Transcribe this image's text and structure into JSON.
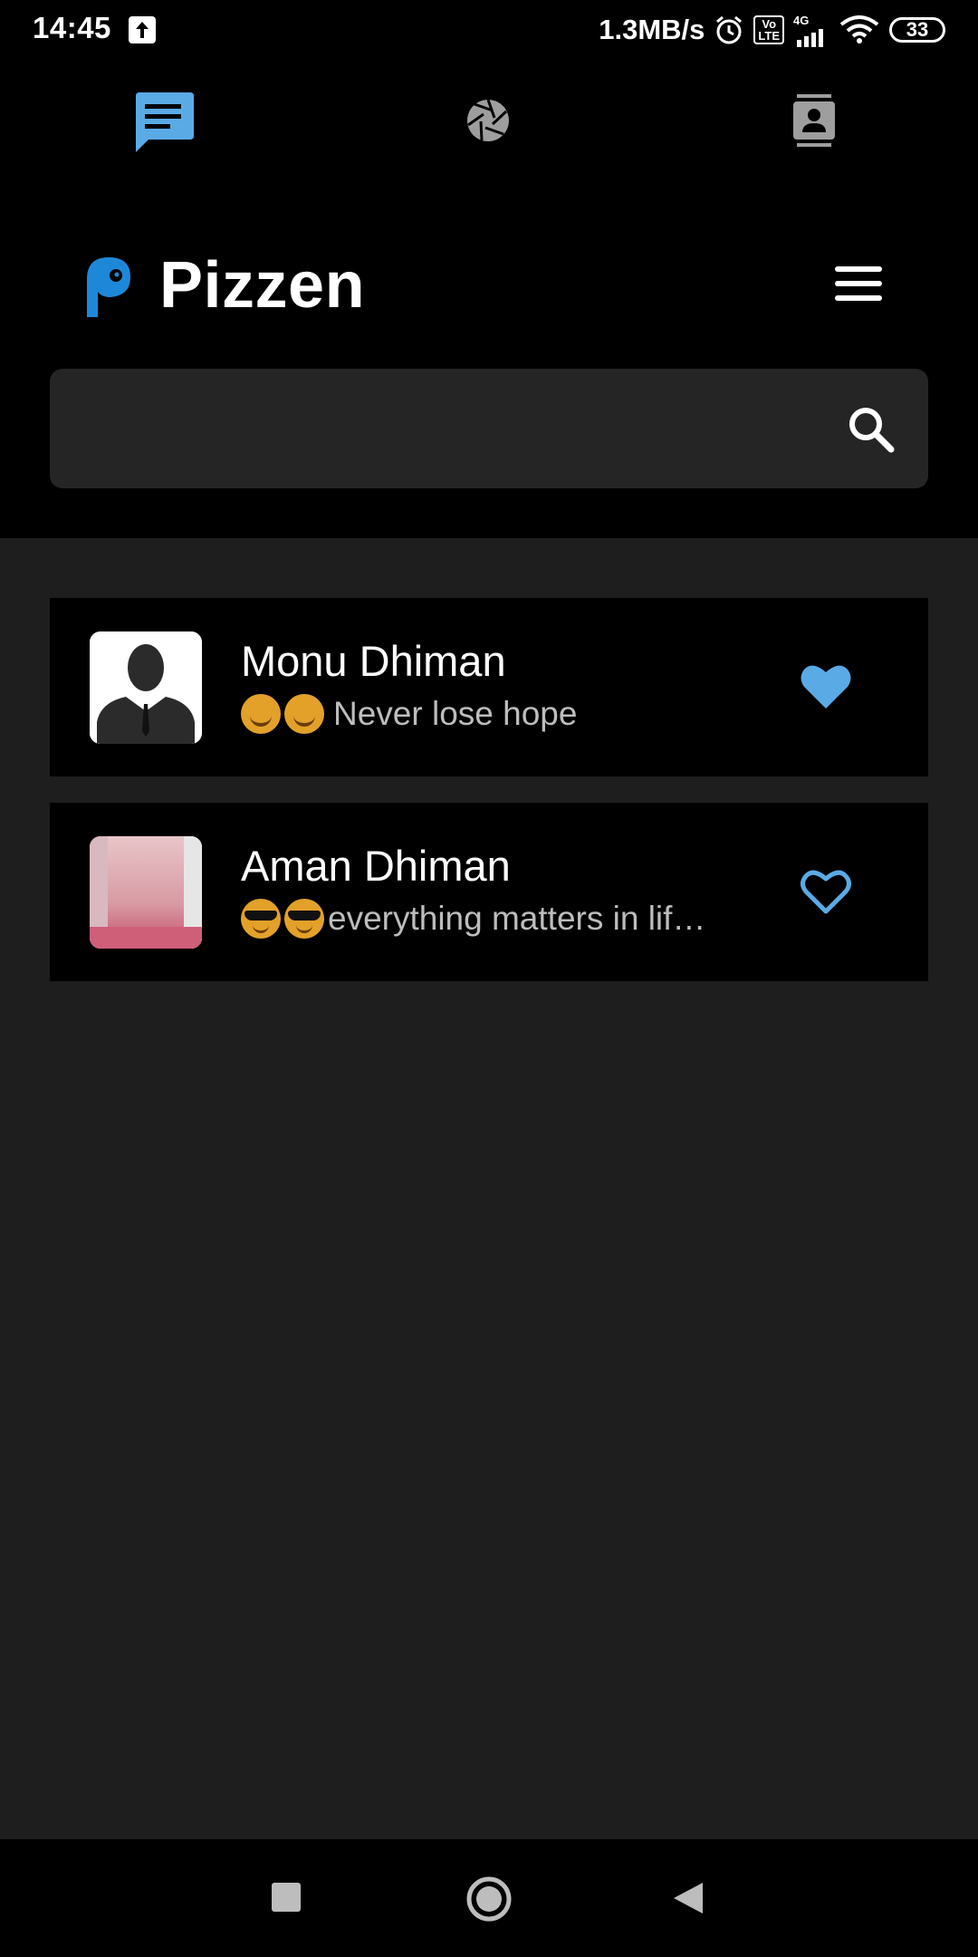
{
  "status_bar": {
    "time": "14:45",
    "net_speed": "1.3MB/s",
    "volte_top": "Vo",
    "volte_bottom": "LTE",
    "network": "4G",
    "battery": "33"
  },
  "top_tabs": [
    {
      "icon": "chat-icon",
      "active": true
    },
    {
      "icon": "camera-aperture-icon",
      "active": false
    },
    {
      "icon": "contacts-icon",
      "active": false
    }
  ],
  "header": {
    "app_name": "Pizzen"
  },
  "search": {
    "value": "",
    "placeholder": ""
  },
  "contacts": [
    {
      "name": "Monu Dhiman",
      "emoji": "🤗🤗",
      "status": "Never lose hope",
      "favorite": true
    },
    {
      "name": "Aman Dhiman",
      "emoji": "😎😎",
      "status": "everything matters in lif…",
      "favorite": false
    }
  ],
  "colors": {
    "accent": "#5aaae6",
    "background": "#1e1e1e",
    "card": "#000000",
    "search_bg": "#252525"
  }
}
